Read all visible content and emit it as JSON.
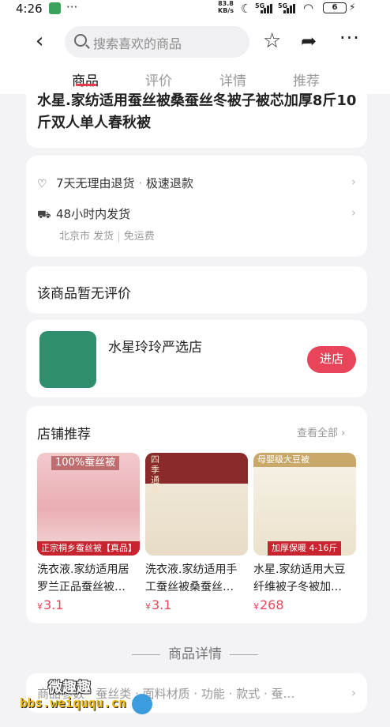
{
  "status": {
    "time": "4:26",
    "dots": "···",
    "speed": "83.8",
    "speed_unit": "KB/s",
    "sig1": "5G",
    "sig2": "5G",
    "battery": "6"
  },
  "nav": {
    "back_icon": "chevron-left-icon",
    "search_placeholder": "搜索喜欢的商品",
    "tabs": [
      {
        "label": "商品",
        "active": true
      },
      {
        "label": "评价",
        "active": false
      },
      {
        "label": "详情",
        "active": false
      },
      {
        "label": "推荐",
        "active": false
      }
    ]
  },
  "product": {
    "title": "水星.家纺适用蚕丝被桑蚕丝冬被子被芯加厚8斤10斤双人单人春秋被"
  },
  "services": {
    "return_label": "7天无理由退货",
    "refund_label": "极速退款",
    "shipping_label": "48小时内发货",
    "ship_from": "北京市 发货",
    "free_shipping": "免运费"
  },
  "review": {
    "empty_text": "该商品暂无评价"
  },
  "shop": {
    "name": "水星玲玲严选店",
    "enter_label": "进店",
    "logo_color": "#2f8f6d"
  },
  "recommend": {
    "title": "店铺推荐",
    "view_all": "查看全部",
    "items": [
      {
        "name": "洗衣液.家纺适用居罗兰正品蚕丝被…",
        "currency": "¥",
        "price": "3.1",
        "img_top_tag": "100%蚕丝被",
        "img_bottom_tag": "正宗桐乡蚕丝被【真品】"
      },
      {
        "name": "洗衣液.家纺适用手工蚕丝被桑蚕丝…",
        "currency": "¥",
        "price": "3.1",
        "img_top_tag": "四季通用",
        "img_bottom_tag": ""
      },
      {
        "name": "水星.家纺适用大豆纤维被子冬被加…",
        "currency": "¥",
        "price": "268",
        "img_top_tag": "母婴级大豆被",
        "img_bottom_tag": "加厚保暖 4-16斤"
      }
    ]
  },
  "detail": {
    "heading": "商品详情",
    "params": "商品参数 · 蚕丝类 · 面料材质 · 功能 · 款式 · 蚕…"
  },
  "watermark": {
    "line1": "微趣趣",
    "line2": "bbs.weiququ.cn"
  },
  "colors": {
    "accent": "#e9455a",
    "background": "#f3f3f5"
  }
}
